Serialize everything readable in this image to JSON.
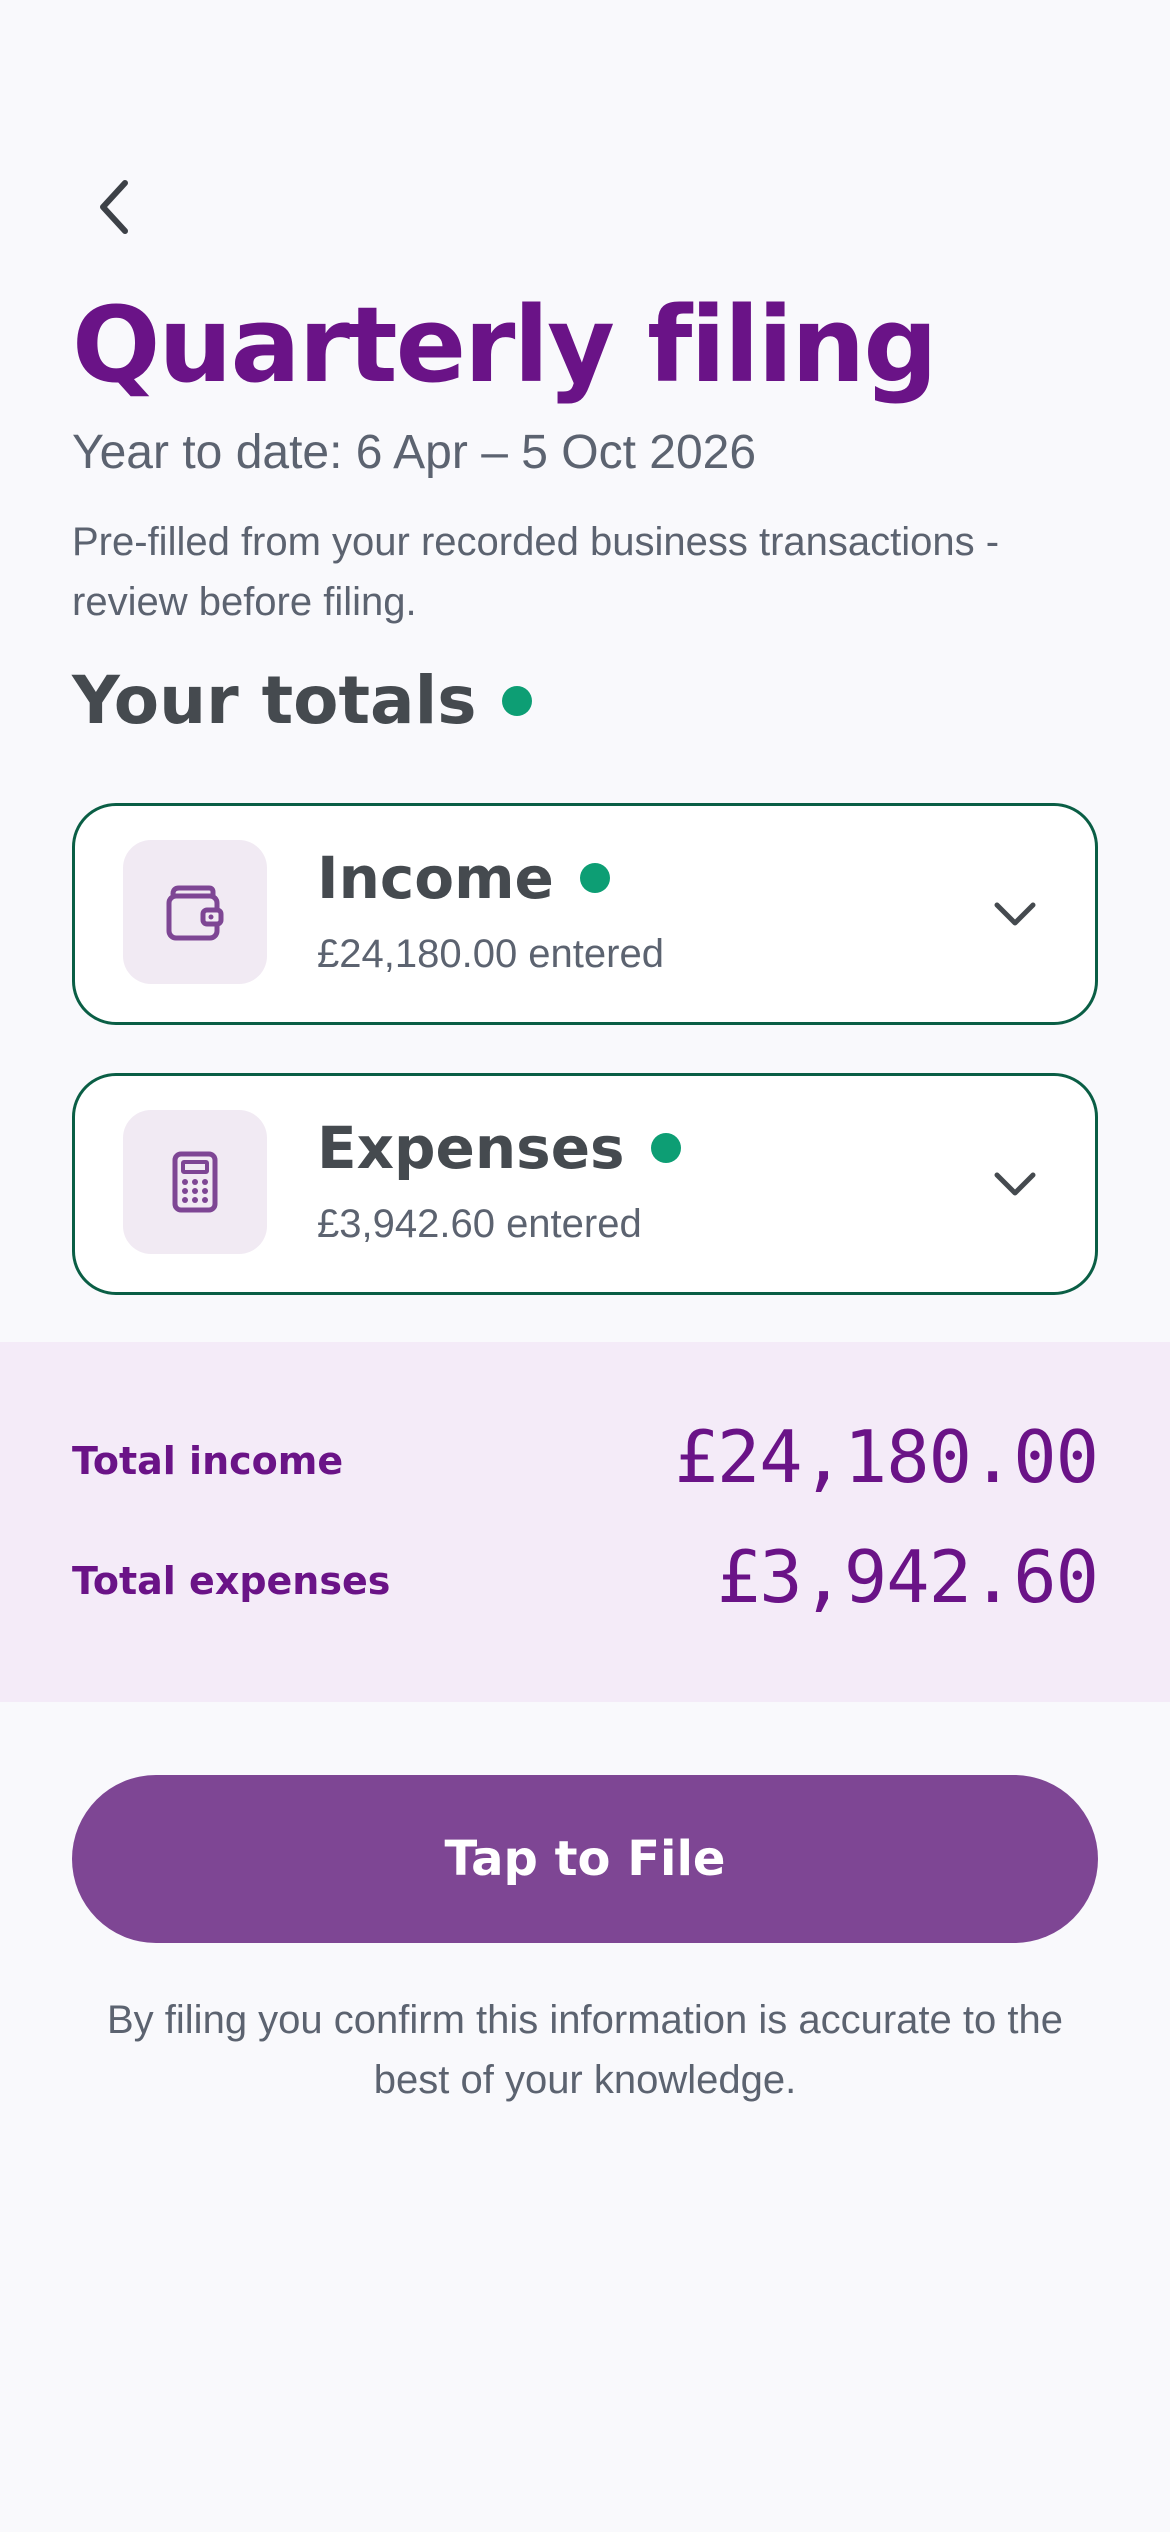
{
  "header": {
    "back_icon": "chevron-left-icon",
    "title": "Quarterly filing",
    "subtitle": "Year to date: 6 Apr – 5 Oct 2026",
    "description": "Pre-filled from your recorded business transactions - review before filing."
  },
  "totals_section": {
    "heading": "Your totals",
    "status_color": "#0d9e74"
  },
  "cards": [
    {
      "title": "Income",
      "detail": "£24,180.00 entered",
      "icon": "wallet-icon"
    },
    {
      "title": "Expenses",
      "detail": "£3,942.60 entered",
      "icon": "calculator-icon"
    }
  ],
  "summary": {
    "income_label": "Total income",
    "income_value": "£24,180.00",
    "expenses_label": "Total expenses",
    "expenses_value": "£3,942.60"
  },
  "action": {
    "file_label": "Tap to File",
    "disclaimer": "By filing you confirm this information is accurate to the best of your knowledge."
  },
  "colors": {
    "brand": "#6a1387",
    "button": "#7e4694",
    "card_border": "#0a5e45",
    "summary_bg": "#f4ebf8"
  }
}
